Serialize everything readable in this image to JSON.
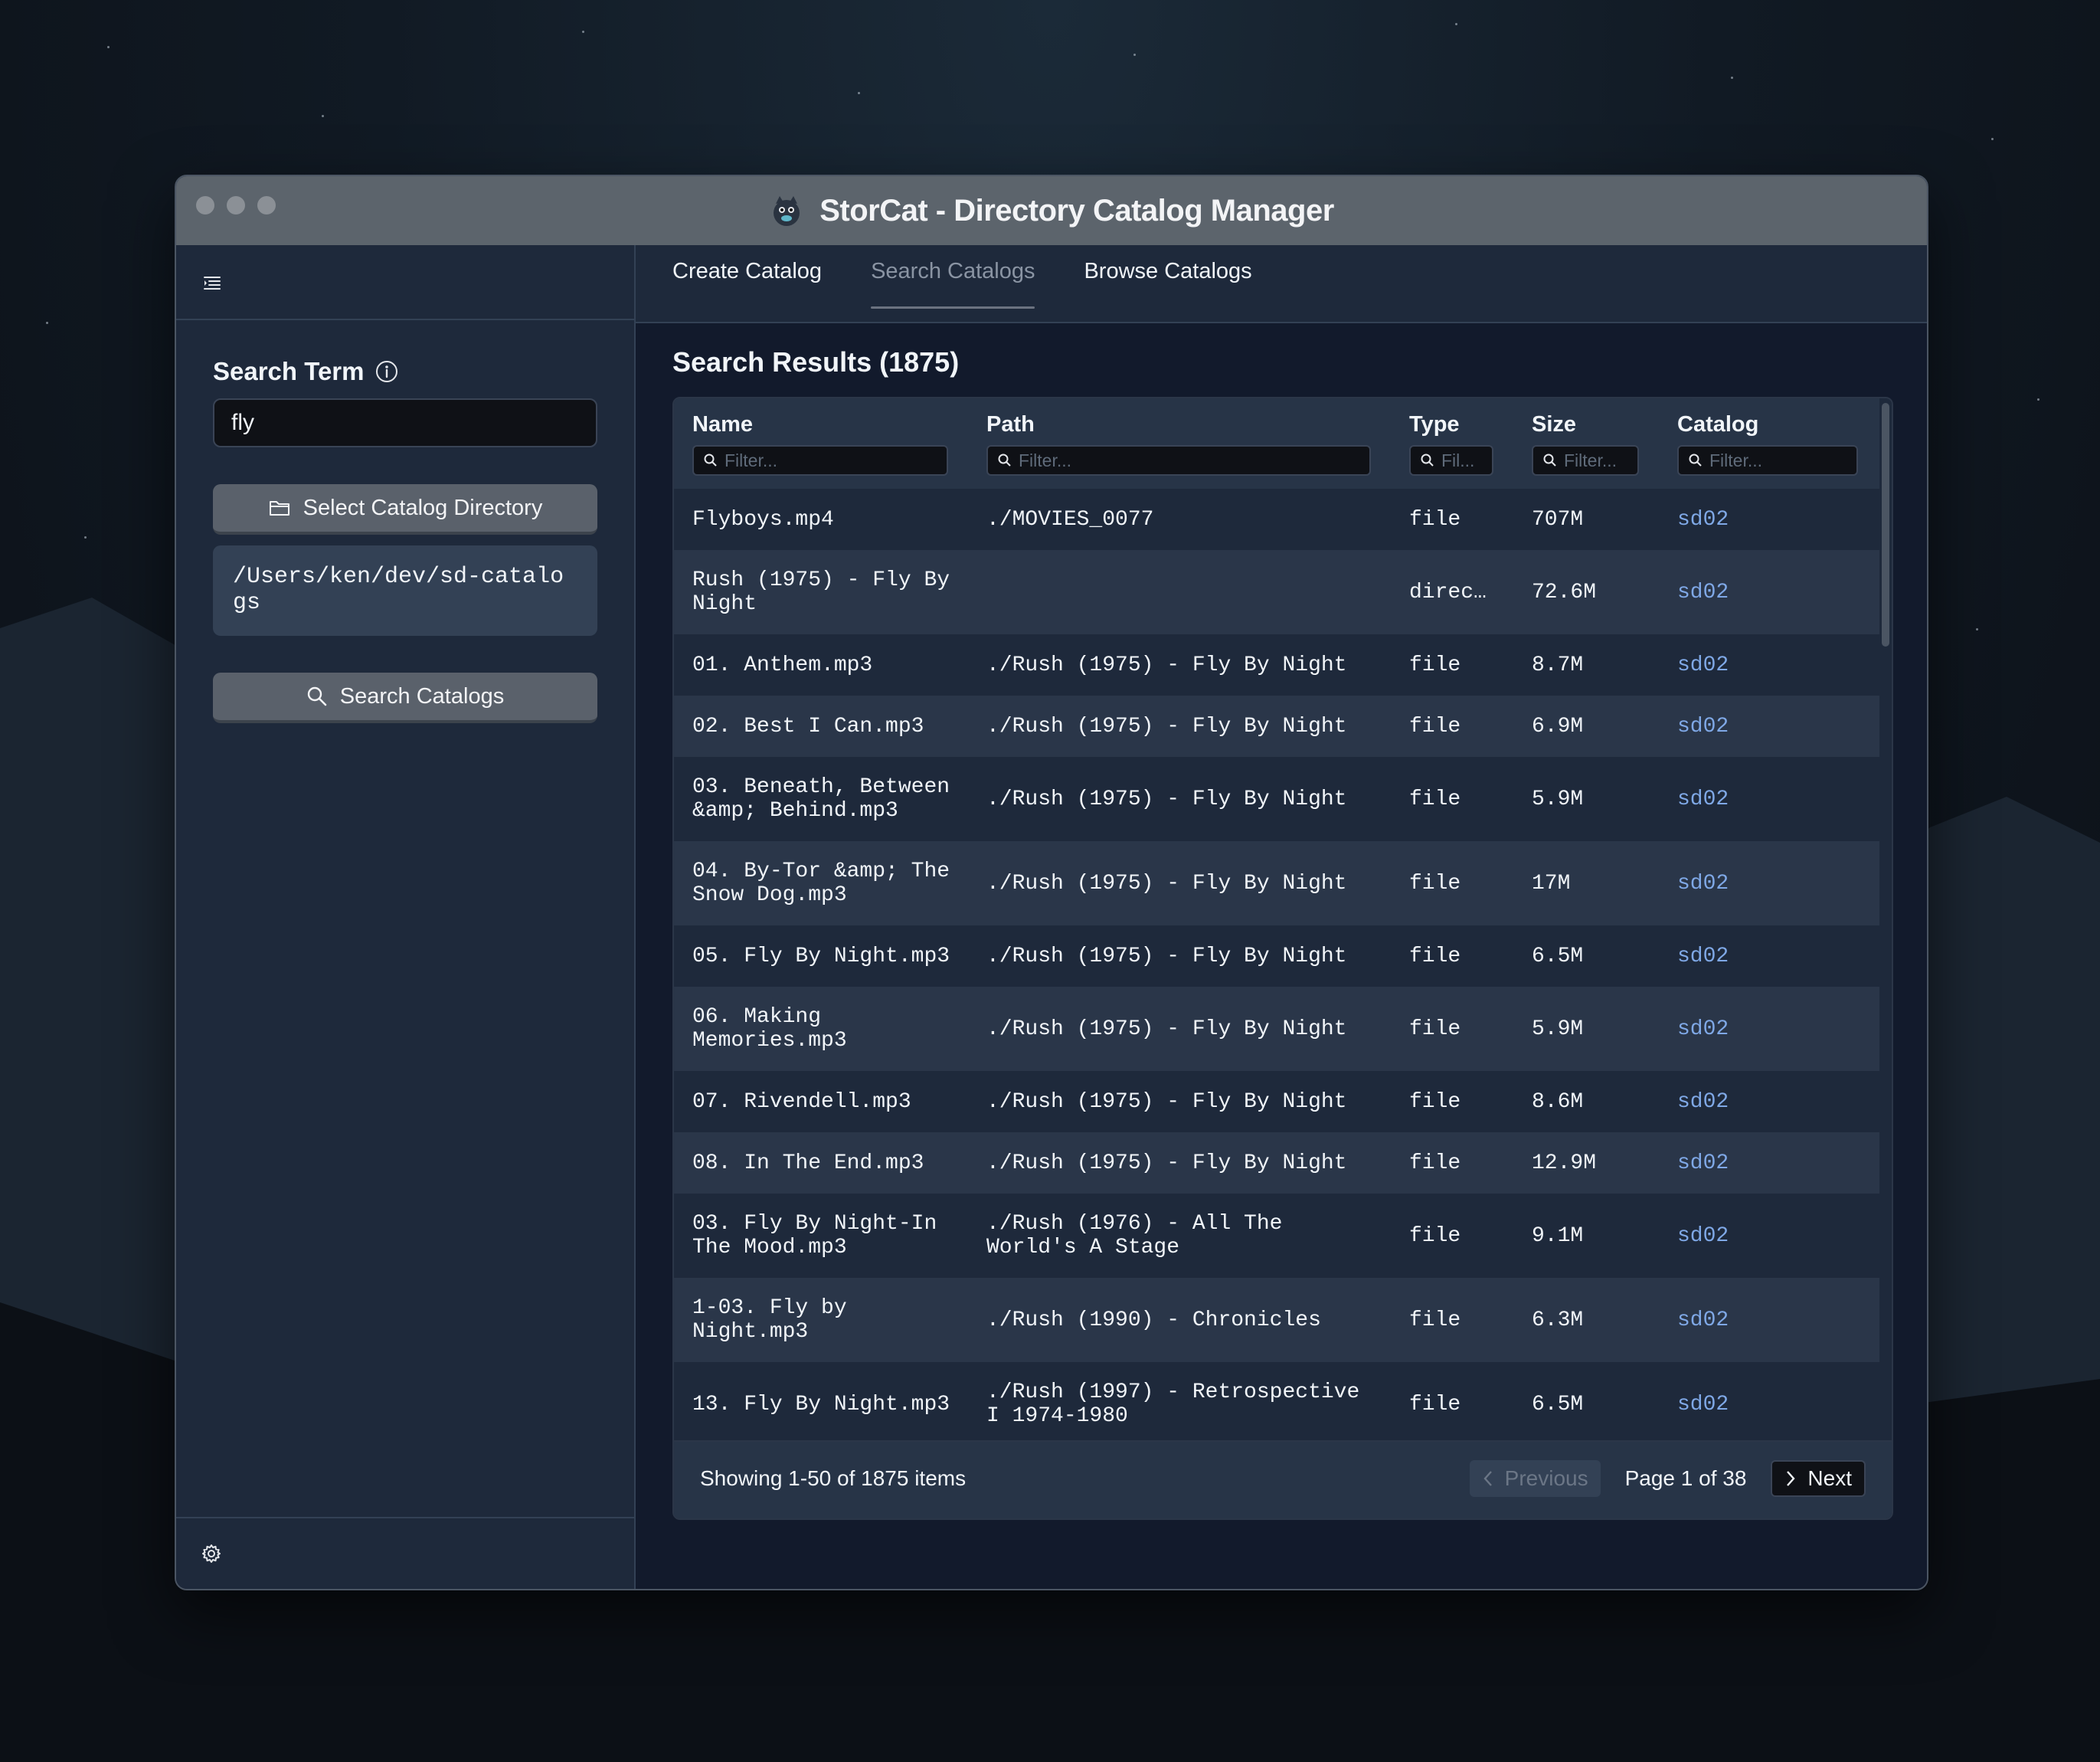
{
  "window": {
    "title": "StorCat - Directory Catalog Manager"
  },
  "sidebar": {
    "search_label": "Search Term",
    "search_value": "fly",
    "select_dir_label": "Select Catalog Directory",
    "catalog_path": "/Users/ken/dev/sd-catalogs",
    "search_button_label": "Search Catalogs"
  },
  "tabs": [
    {
      "label": "Create Catalog",
      "active": false
    },
    {
      "label": "Search Catalogs",
      "active": true
    },
    {
      "label": "Browse Catalogs",
      "active": false
    }
  ],
  "results": {
    "title": "Search Results (1875)",
    "columns": [
      {
        "label": "Name",
        "filter_placeholder": "Filter..."
      },
      {
        "label": "Path",
        "filter_placeholder": "Filter..."
      },
      {
        "label": "Type",
        "filter_placeholder": "Fil..."
      },
      {
        "label": "Size",
        "filter_placeholder": "Filter..."
      },
      {
        "label": "Catalog",
        "filter_placeholder": "Filter..."
      }
    ],
    "rows": [
      {
        "name": "Flyboys.mp4",
        "path": "./MOVIES_0077",
        "type": "file",
        "size": "707M",
        "catalog": "sd02"
      },
      {
        "name": "Rush (1975) - Fly By\nNight",
        "path": "",
        "type": "direc…",
        "size": "72.6M",
        "catalog": "sd02"
      },
      {
        "name": "01. Anthem.mp3",
        "path": "./Rush (1975) - Fly By Night",
        "type": "file",
        "size": "8.7M",
        "catalog": "sd02"
      },
      {
        "name": "02. Best I Can.mp3",
        "path": "./Rush (1975) - Fly By Night",
        "type": "file",
        "size": "6.9M",
        "catalog": "sd02"
      },
      {
        "name": "03. Beneath, Between\n&amp; Behind.mp3",
        "path": "./Rush (1975) - Fly By Night",
        "type": "file",
        "size": "5.9M",
        "catalog": "sd02"
      },
      {
        "name": "04. By-Tor &amp; The\nSnow Dog.mp3",
        "path": "./Rush (1975) - Fly By Night",
        "type": "file",
        "size": "17M",
        "catalog": "sd02"
      },
      {
        "name": "05. Fly By Night.mp3",
        "path": "./Rush (1975) - Fly By Night",
        "type": "file",
        "size": "6.5M",
        "catalog": "sd02"
      },
      {
        "name": "06. Making\nMemories.mp3",
        "path": "./Rush (1975) - Fly By Night",
        "type": "file",
        "size": "5.9M",
        "catalog": "sd02"
      },
      {
        "name": "07. Rivendell.mp3",
        "path": "./Rush (1975) - Fly By Night",
        "type": "file",
        "size": "8.6M",
        "catalog": "sd02"
      },
      {
        "name": "08. In The End.mp3",
        "path": "./Rush (1975) - Fly By Night",
        "type": "file",
        "size": "12.9M",
        "catalog": "sd02"
      },
      {
        "name": "03. Fly By Night-In\nThe Mood.mp3",
        "path": "./Rush (1976) - All The\nWorld's A Stage",
        "type": "file",
        "size": "9.1M",
        "catalog": "sd02"
      },
      {
        "name": "1-03. Fly by\nNight.mp3",
        "path": "./Rush (1990) - Chronicles",
        "type": "file",
        "size": "6.3M",
        "catalog": "sd02"
      },
      {
        "name": "13. Fly By Night.mp3",
        "path": "./Rush (1997) - Retrospective\nI 1974-1980",
        "type": "file",
        "size": "6.5M",
        "catalog": "sd02"
      }
    ],
    "showing": "Showing 1-50 of 1875 items",
    "prev_label": "Previous",
    "next_label": "Next",
    "page_info": "Page 1 of 38"
  },
  "colors": {
    "catalog_link": "#7fa8e6",
    "row_dark": "#1e293b",
    "row_light": "#2a3649"
  }
}
